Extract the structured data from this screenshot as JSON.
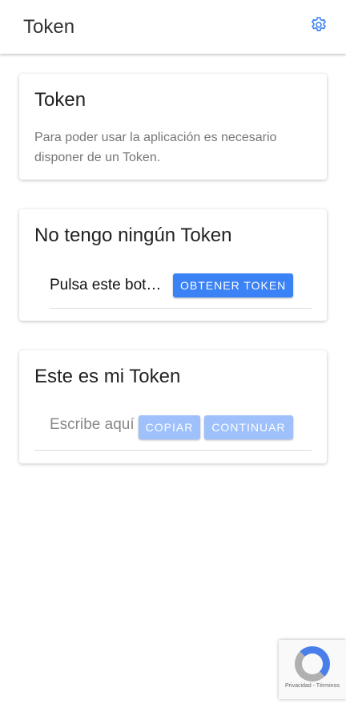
{
  "header": {
    "title": "Token",
    "settings_icon": "gear-icon",
    "accent": "#3b82f6"
  },
  "card_info": {
    "title": "Token",
    "text": "Para poder usar la aplicación es necesario disponer de un Token."
  },
  "card_get": {
    "title": "No tengo ningún Token",
    "label": "Pulsa este bot…",
    "button": "OBTENER TOKEN"
  },
  "card_mine": {
    "title": "Este es mi Token",
    "placeholder": "Escribe aquí",
    "copy": "COPIAR",
    "continue": "CONTINUAR"
  },
  "recaptcha": {
    "links": "Privacidad - Términos"
  }
}
